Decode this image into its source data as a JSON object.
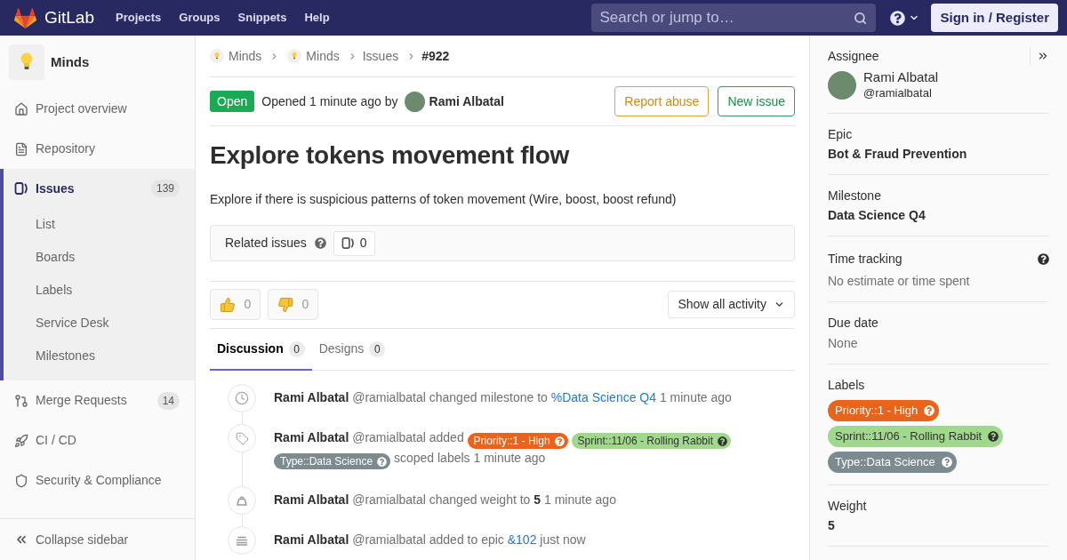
{
  "top_bar": {
    "brand": "GitLab",
    "nav": [
      {
        "label": "Projects"
      },
      {
        "label": "Groups"
      },
      {
        "label": "Snippets"
      },
      {
        "label": "Help"
      }
    ],
    "search": {
      "placeholder": "Search or jump to…"
    },
    "sign_in": "Sign in / Register"
  },
  "sidebar": {
    "project": "Minds",
    "items": [
      {
        "label": "Project overview",
        "selected": false
      },
      {
        "label": "Repository",
        "selected": false
      },
      {
        "label": "Issues",
        "count": "139",
        "selected": true,
        "children": [
          {
            "label": "List",
            "selected": false
          },
          {
            "label": "Boards",
            "selected": false
          },
          {
            "label": "Labels",
            "selected": false
          },
          {
            "label": "Service Desk",
            "selected": false
          },
          {
            "label": "Milestones",
            "selected": false
          }
        ]
      },
      {
        "label": "Merge Requests",
        "count": "14",
        "selected": false
      },
      {
        "label": "CI / CD",
        "selected": false
      },
      {
        "label": "Security & Compliance",
        "selected": false
      }
    ],
    "collapse": "Collapse sidebar"
  },
  "breadcrumbs": [
    {
      "text": "Minds",
      "kind": "project"
    },
    {
      "text": "Minds",
      "kind": "project"
    },
    {
      "text": "Issues",
      "kind": "link"
    },
    {
      "text": "#922",
      "kind": "current"
    }
  ],
  "issue": {
    "status": "Open",
    "opened": "Opened 1 minute ago by",
    "author": "Rami Albatal",
    "actions": [
      {
        "label": "Report abuse",
        "kind": "warning"
      },
      {
        "label": "New issue",
        "kind": "success"
      }
    ],
    "title": "Explore tokens movement flow",
    "description": "Explore if there is suspicious patterns of token movement (Wire, boost, boost refund)",
    "related": {
      "label": "Related issues",
      "count": "0"
    },
    "awards": [
      {
        "kind": "thumbsup",
        "count": "0"
      },
      {
        "kind": "thumbsdown",
        "count": "0"
      }
    ],
    "activity_filter": "Show all activity",
    "tabs": [
      {
        "label": "Discussion",
        "count": "0",
        "selected": true
      },
      {
        "label": "Designs",
        "count": "0",
        "selected": false
      }
    ],
    "events": [
      {
        "kind": "milestone",
        "author": "Rami Albatal",
        "handle": "@ramialbatal",
        "parts": [
          {
            "kind": "text",
            "text": "changed milestone to"
          },
          {
            "kind": "link",
            "text": "%Data Science Q4"
          },
          {
            "kind": "text",
            "text": "1 minute ago"
          }
        ]
      },
      {
        "kind": "labels",
        "author": "Rami Albatal",
        "handle": "@ramialbatal",
        "parts": [
          {
            "kind": "text",
            "text": "added"
          },
          {
            "kind": "label",
            "text": "Priority::1 - High",
            "color": "#e9631b"
          },
          {
            "kind": "label",
            "text": "Sprint::11/06 - Rolling Rabbit",
            "color": "#a1d98c"
          },
          {
            "kind": "label",
            "text": "Type::Data Science",
            "color": "#7b8b90"
          },
          {
            "kind": "text",
            "text": "scoped labels 1 minute ago"
          }
        ]
      },
      {
        "kind": "weight",
        "author": "Rami Albatal",
        "handle": "@ramialbatal",
        "parts": [
          {
            "kind": "text",
            "text": "changed weight to **5** 1 minute ago"
          }
        ]
      },
      {
        "kind": "epic",
        "author": "Rami Albatal",
        "handle": "@ramialbatal",
        "parts": [
          {
            "kind": "text",
            "text": "added to epic"
          },
          {
            "kind": "link",
            "text": "&102"
          },
          {
            "kind": "text",
            "text": "just now"
          }
        ]
      }
    ]
  },
  "right_sidebar": {
    "sections": [
      {
        "kind": "user",
        "title": "Assignee",
        "name": "Rami Albatal",
        "handle": "@ramialbatal",
        "help": false
      },
      {
        "kind": "strong",
        "title": "Epic",
        "value": "Bot & Fraud Prevention",
        "help": false
      },
      {
        "kind": "strong",
        "title": "Milestone",
        "value": "Data Science Q4",
        "help": false
      },
      {
        "kind": "muted",
        "title": "Time tracking",
        "value": "No estimate or time spent",
        "help": true
      },
      {
        "kind": "muted",
        "title": "Due date",
        "value": "None",
        "help": false
      },
      {
        "kind": "labels",
        "title": "Labels",
        "labels": [
          {
            "text": "Priority::1 - High",
            "color": "#e9631b"
          },
          {
            "text": "Sprint::11/06 - Rolling Rabbit",
            "color": "#a1d98c"
          },
          {
            "text": "Type::Data Science",
            "color": "#7b8b90"
          }
        ],
        "help": false
      },
      {
        "kind": "strong",
        "title": "Weight",
        "value": "5",
        "help": false
      }
    ]
  }
}
